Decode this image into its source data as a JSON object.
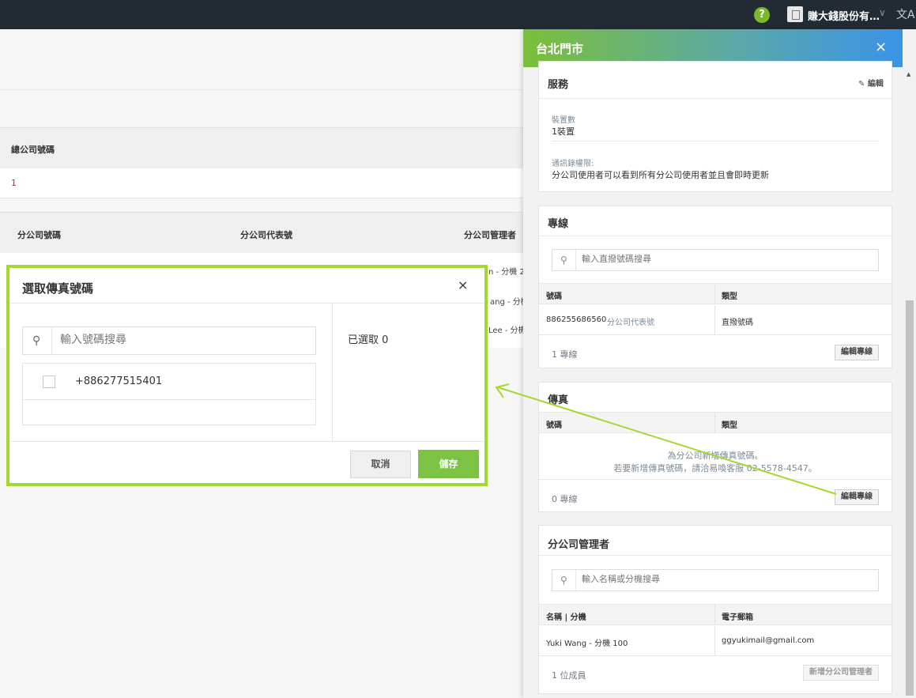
{
  "topbar": {
    "help_icon": "?",
    "company_name": "賺大錢股份有…",
    "company_caret": "∨",
    "translate_icon": "文A"
  },
  "background": {
    "hq_column": "總公司號碼",
    "hq_value": "1",
    "branch_columns": [
      "分公司號碼",
      "分公司代表號",
      "分公司管理者"
    ],
    "row_fragments": [
      "n - 分機 2",
      "ang - 分機",
      "Lee - 分機"
    ]
  },
  "panel": {
    "title": "台北門市",
    "close_icon": "×",
    "service": {
      "title": "服務",
      "edit_label": "編輯",
      "devices_label": "裝置數",
      "devices_value": "1裝置",
      "directory_label": "通訊錄權限:",
      "directory_value": "分公司使用者可以看到所有分公司使用者並且會即時更新"
    },
    "lines": {
      "title": "專線",
      "search_placeholder": "輸入直撥號碼搜尋",
      "col_number": "號碼",
      "col_type": "類型",
      "row_number": "886255686560",
      "row_tag": "分公司代表號",
      "row_type": "直撥號碼",
      "count": "1 專線",
      "edit_button": "編輯專線"
    },
    "fax": {
      "title": "傳真",
      "col_number": "號碼",
      "col_type": "類型",
      "empty_line1": "為分公司新增傳真號碼。",
      "empty_line2": "若要新增傳真號碼，請洽易喚客服 02-5578-4547。",
      "count": "0 專線",
      "edit_button": "編輯專線"
    },
    "managers": {
      "title": "分公司管理者",
      "search_placeholder": "輸入名稱或分機搜尋",
      "col_name": "名稱 | 分機",
      "col_email": "電子郵箱",
      "row_name": "Yuki Wang - 分機 100",
      "row_email": "ggyukimail@gmail.com",
      "count": "1 位成員",
      "add_button": "新增分公司管理者"
    }
  },
  "modal": {
    "title": "選取傳真號碼",
    "close_icon": "×",
    "search_placeholder": "輸入號碼搜尋",
    "numbers": [
      "+886277515401"
    ],
    "selected_label": "已選取 0",
    "cancel_label": "取消",
    "save_label": "儲存"
  },
  "colors": {
    "topbar": "#222b33",
    "accent_green": "#7cc243",
    "highlight": "#a3d82e",
    "header_gradient_start": "#7cbf3a",
    "header_gradient_end": "#3b93e8"
  }
}
